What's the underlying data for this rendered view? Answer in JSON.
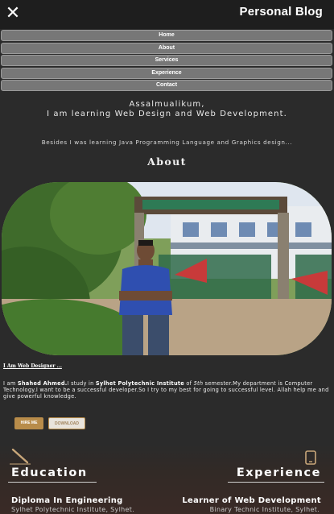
{
  "header": {
    "close_icon": "close-icon",
    "brand": "Personal Blog"
  },
  "menu": {
    "items": [
      {
        "label": "Home"
      },
      {
        "label": "About"
      },
      {
        "label": "Services"
      },
      {
        "label": "Experience"
      },
      {
        "label": "Contact"
      }
    ]
  },
  "intro": {
    "greeting_line1": "Assalmualikum,",
    "greeting_line2": "I am learning Web Design and Web Development.",
    "besides": "Besides I was learning Java Programming Language and Graphics design..."
  },
  "about": {
    "title": "About",
    "caption": "I Am Web Designer ...",
    "bio_prefix": "I am ",
    "bio_name": "Shahed Ahmed.",
    "bio_mid1": "I study in ",
    "bio_institute": "Sylhet Polytechnic Institute",
    "bio_mid2": " of ",
    "bio_semester": "5th",
    "bio_rest": " semester.My department is Computer Technology.I want to be a successful developer.So I try to my best for going to successful level. Allah help me and give powerful knowledge.",
    "hire_label": "HIRE ME",
    "download_label": "DOWNLOAD"
  },
  "education": {
    "title": "Education",
    "icon": "pencil-icon",
    "item_title": "Diploma In Engineering",
    "item_sub": "Sylhet Polytechnic Institute, Sylhet."
  },
  "experience": {
    "title": "Experience",
    "icon": "phone-icon",
    "item_title": "Learner of Web Development",
    "item_sub": "Binary Technic Institute, Sylhet."
  },
  "colors": {
    "background": "#2b2b2b",
    "topbar": "#1e1e1e",
    "menu_item": "#777777",
    "accent_gold": "#b88c4a"
  }
}
